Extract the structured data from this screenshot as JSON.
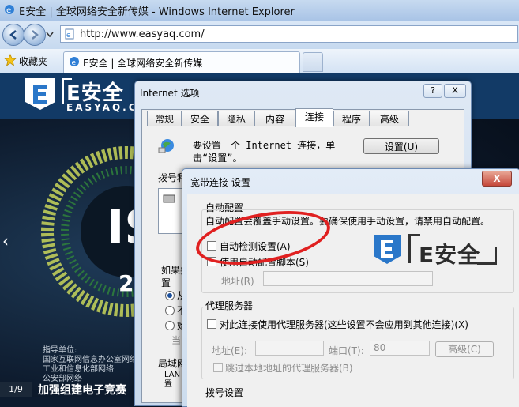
{
  "browser": {
    "window_title": "E安全 | 全球网络安全新传媒 - Windows Internet Explorer",
    "url": "http://www.easyaq.com/",
    "favorites_label": "收藏夹",
    "tab_title": "E安全 | 全球网络安全新传媒"
  },
  "site": {
    "logo_text": "E安全",
    "logo_sub": "EASYAQ.COM",
    "hero_text": "IS",
    "hero_num": "2",
    "org_lines": [
      "指导单位:",
      "国家互联网信息办公室网络",
      "工业和信息化部网络",
      "公安部网络"
    ],
    "page_indicator": "1/9",
    "caption": "加强组建电子竞赛"
  },
  "inet_dialog": {
    "title": "Internet 选项",
    "help": "?",
    "close": "X",
    "tabs": [
      "常规",
      "安全",
      "隐私",
      "内容",
      "连接",
      "程序",
      "高级"
    ],
    "active_tab": 4,
    "setup_text": "要设置一个 Internet 连接，单击“设置”。",
    "setup_button": "设置(U)",
    "dial_label": "拨号和",
    "if_text": [
      "如果要",
      "置"
    ],
    "radio_labels": [
      "从",
      "不",
      "始"
    ],
    "radio_current": "当",
    "lan_label": "局域网",
    "lan_desc": [
      "LAN",
      "置"
    ]
  },
  "bb_dialog": {
    "title": "宽带连接 设置",
    "close": "X",
    "auto_section": "自动配置",
    "auto_desc": "自动配置会覆盖手动设置。要确保使用手动设置，请禁用自动配置。",
    "auto_detect": "自动检测设置(A)",
    "auto_script": "使用自动配置脚本(S)",
    "address_label": "地址(R)",
    "proxy_section": "代理服务器",
    "proxy_use": "对此连接使用代理服务器(这些设置不会应用到其他连接)(X)",
    "proxy_address": "地址(E):",
    "proxy_port": "端口(T):",
    "proxy_port_value": "80",
    "advanced_button": "高级(C)",
    "bypass_local": "跳过本地地址的代理服务器(B)",
    "dial_section": "拨号设置",
    "watermark": "E安全"
  },
  "colors": {
    "annotation": "#e02020",
    "site_bg": "#0d1b2e",
    "brand": "#2a77c9"
  }
}
